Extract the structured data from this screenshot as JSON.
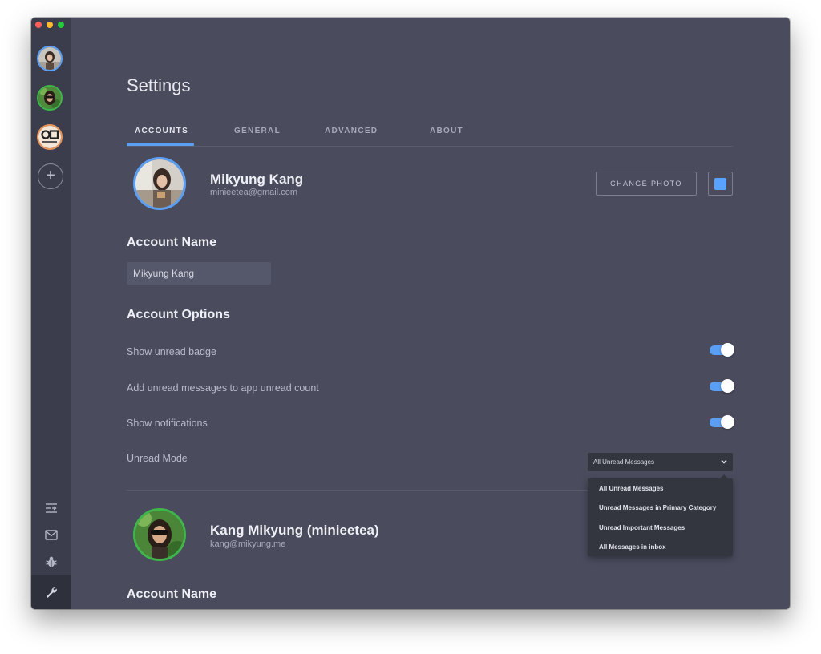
{
  "sidebar": {
    "accounts": [
      {
        "name": "account-1",
        "ring": "#5a9ff3"
      },
      {
        "name": "account-2",
        "ring": "#3fb54a"
      },
      {
        "name": "account-3",
        "ring": "#e8955a"
      }
    ],
    "bottom_icons": [
      "compose-icon",
      "mail-icon",
      "bug-icon",
      "wrench-icon"
    ]
  },
  "settings": {
    "title": "Settings",
    "tabs": [
      {
        "label": "ACCOUNTS",
        "active": true
      },
      {
        "label": "GENERAL",
        "active": false
      },
      {
        "label": "ADVANCED",
        "active": false
      },
      {
        "label": "ABOUT",
        "active": false
      }
    ],
    "account1": {
      "name": "Mikyung Kang",
      "email": "minieetea@gmail.com",
      "change_photo": "CHANGE PHOTO",
      "color": "#5aa2ff",
      "ring": "#5a9ff3",
      "account_name_title": "Account Name",
      "account_name_value": "Mikyung Kang",
      "options_title": "Account Options",
      "options": [
        {
          "label": "Show unread badge",
          "on": true
        },
        {
          "label": "Add unread messages to app unread count",
          "on": true
        },
        {
          "label": "Show notifications",
          "on": true
        }
      ],
      "unread_mode_label": "Unread Mode",
      "unread_mode_selected": "All Unread Messages",
      "unread_mode_options": [
        "All Unread Messages",
        "Unread Messages in Primary Category",
        "Unread Important Messages",
        "All Messages in inbox"
      ]
    },
    "account2": {
      "name": "Kang Mikyung (minieetea)",
      "email": "kang@mikyung.me",
      "ring": "#3fb54a",
      "account_name_title": "Account Name"
    }
  }
}
